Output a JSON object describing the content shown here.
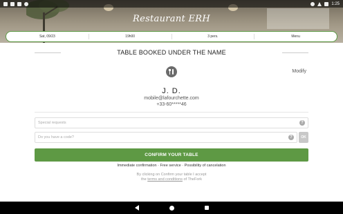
{
  "status_bar": {
    "time": "1:25",
    "left_icons": [
      "app-icon",
      "sim-icon",
      "close-notification-icon",
      "sync-icon"
    ],
    "right_icons": [
      "location-icon",
      "wifi-icon",
      "battery-icon"
    ]
  },
  "header": {
    "restaurant_name": "Restaurant ERH"
  },
  "booking": {
    "date": "Sat, 09/23",
    "time": "19h00",
    "party_size": "3 pers.",
    "menu": "Menu"
  },
  "section_title": "TABLE BOOKED UNDER THE NAME",
  "modify_label": "Modify",
  "guest": {
    "name": "J. D.",
    "email": "mobile@lafourchette.com",
    "phone": "+33-60*****46"
  },
  "form": {
    "special_requests_placeholder": "Special requests",
    "code_placeholder": "Do you have a code?",
    "ok_label": "OK",
    "help_glyph": "?"
  },
  "confirm_label": "CONFIRM YOUR TABLE",
  "benefits_text": "Immediate confirmation · Free service · Possibility of cancelation",
  "terms": {
    "line1": "By clicking on Confirm your table I accept",
    "prefix": "the",
    "link": "terms and conditions",
    "suffix": "of TheFork"
  },
  "colors": {
    "accent_green": "#5e9944",
    "text_dark": "#222222",
    "muted": "#999999"
  }
}
